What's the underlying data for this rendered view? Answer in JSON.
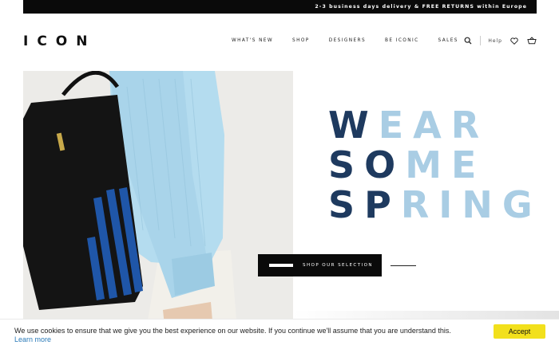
{
  "promo": {
    "text": "2-3 business days delivery & FREE RETURNS within Europe"
  },
  "header": {
    "logo": "ICON",
    "nav": [
      {
        "label": "WHAT'S NEW"
      },
      {
        "label": "SHOP"
      },
      {
        "label": "DESIGNERS"
      },
      {
        "label": "BE ICONIC"
      },
      {
        "label": "SALES"
      }
    ],
    "help_label": "Help",
    "icons": [
      "search-icon",
      "heart-icon",
      "basket-icon"
    ]
  },
  "hero": {
    "image": "model-with-black-tote-bag-and-light-blue-sweater",
    "line1_dark": "W",
    "line1_light": "EAR",
    "line2_dark": "SO",
    "line2_light": "ME",
    "line3_dark": "SP",
    "line3_light": "RING",
    "cta_label": "SHOP OUR SELECTION"
  },
  "cookie": {
    "text": "We use cookies to ensure that we give you the best experience on our website. If you continue we'll assume that you are understand this.",
    "link": "Learn more",
    "accept_label": "Accept"
  },
  "colors": {
    "accent_yellow": "#f2e01c",
    "promo_bg": "#0a0a0a",
    "link_blue": "#2a7ab8"
  }
}
